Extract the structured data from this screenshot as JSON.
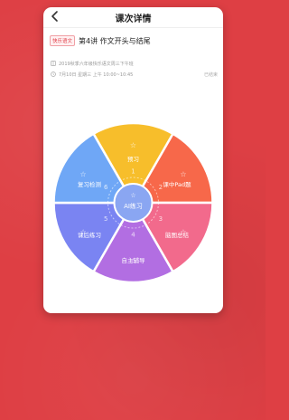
{
  "header": {
    "title": "课次详情"
  },
  "lesson": {
    "tag": "快乐语文",
    "title": "第4讲  作文开头与结尾",
    "course": "2019秋季六年级快乐语文周三下午班",
    "time": "7月10日 星期三 上午 10:00~10:45",
    "status": "已结束"
  },
  "wheel": {
    "center": "AI练习",
    "segments": [
      {
        "num": "1",
        "label": "预习",
        "color": "#f7be2b"
      },
      {
        "num": "2",
        "label": "课中Pad题",
        "color": "#f7684a"
      },
      {
        "num": "3",
        "label": "脑图总结",
        "color": "#f26a8c"
      },
      {
        "num": "4",
        "label": "自主辅导",
        "color": "#b26ee2"
      },
      {
        "num": "5",
        "label": "课后练习",
        "color": "#7a84f2"
      },
      {
        "num": "6",
        "label": "复习检测",
        "color": "#6fa7f6"
      }
    ]
  },
  "icons": {
    "back": "chevron-left-icon",
    "course": "book-icon",
    "time": "clock-icon",
    "segment": "star-icon"
  }
}
